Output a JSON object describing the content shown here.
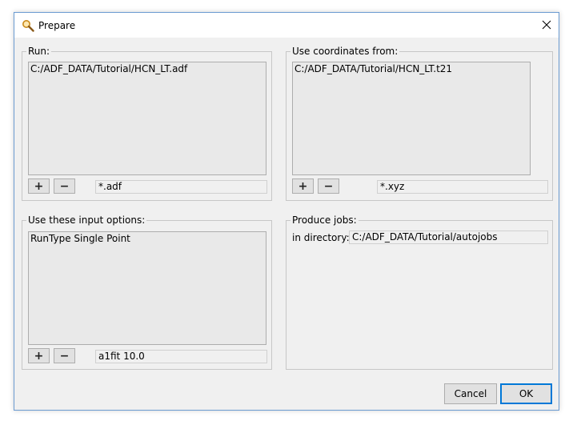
{
  "window": {
    "title": "Prepare",
    "icon": "magnifier-icon"
  },
  "run": {
    "label": "Run:",
    "items": [
      "C:/ADF_DATA/Tutorial/HCN_LT.adf"
    ],
    "add_label": "+",
    "remove_label": "−",
    "filter": "*.adf"
  },
  "coords": {
    "label": "Use coordinates from:",
    "items": [
      "C:/ADF_DATA/Tutorial/HCN_LT.t21"
    ],
    "add_label": "+",
    "remove_label": "−",
    "filter": "*.xyz"
  },
  "options": {
    "label": "Use these input options:",
    "items": [
      "RunType Single Point"
    ],
    "add_label": "+",
    "remove_label": "−",
    "entry": "a1fit 10.0"
  },
  "produce": {
    "label": "Produce jobs:",
    "dir_label": "in directory:",
    "dir_value": "C:/ADF_DATA/Tutorial/autojobs"
  },
  "buttons": {
    "cancel": "Cancel",
    "ok": "OK"
  }
}
